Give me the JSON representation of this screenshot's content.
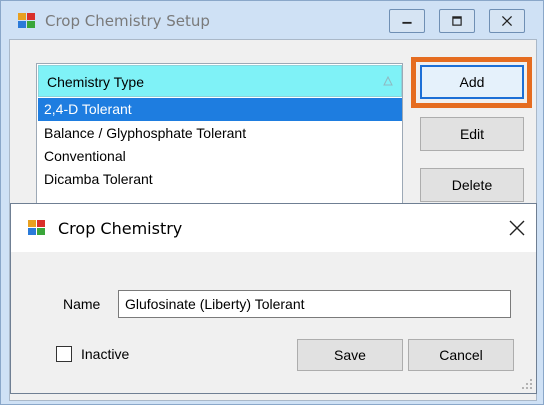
{
  "back_window": {
    "title": "Crop Chemistry Setup",
    "list": {
      "header": "Chemistry Type",
      "rows": [
        {
          "label": "2,4-D Tolerant",
          "selected": true
        },
        {
          "label": "Balance / Glyphosphate Tolerant",
          "selected": false
        },
        {
          "label": "Conventional",
          "selected": false
        },
        {
          "label": "Dicamba Tolerant",
          "selected": false
        }
      ]
    },
    "buttons": {
      "add": "Add",
      "edit": "Edit",
      "delete": "Delete"
    }
  },
  "dialog": {
    "title": "Crop Chemistry",
    "name_label": "Name",
    "name_value": "Glufosinate (Liberty) Tolerant",
    "inactive_label": "Inactive",
    "inactive_checked": false,
    "save_label": "Save",
    "cancel_label": "Cancel"
  },
  "icons": {
    "app": "app-window-icon",
    "minimize": "minimize-icon",
    "maximize": "restore-icon",
    "close": "close-icon",
    "sort": "sort-ascending-icon"
  },
  "colors": {
    "highlight": "#e56c20",
    "selected_row": "#1e7de0",
    "header_bg": "#7ff2f7"
  }
}
